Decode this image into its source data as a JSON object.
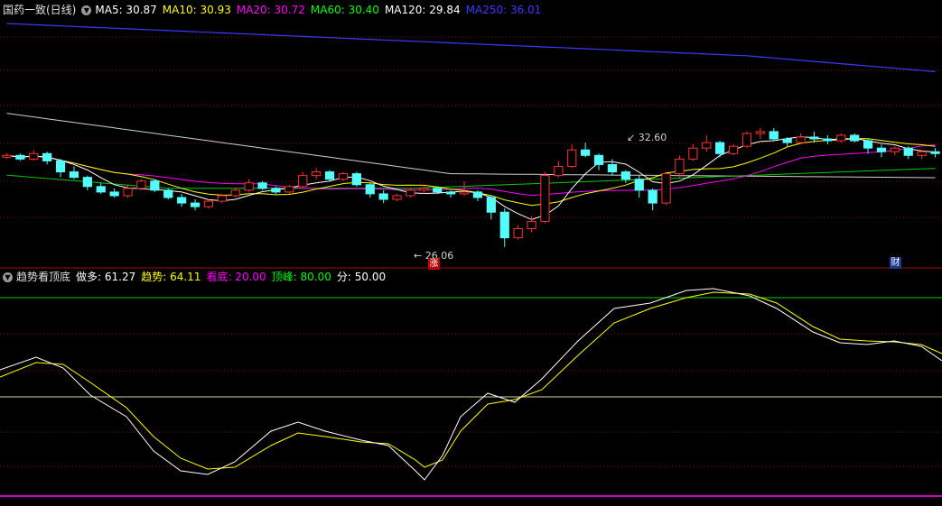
{
  "main_header": {
    "title": "国药一致(日线)",
    "indicators": [
      {
        "label": "MA5: 30.87",
        "color": "#ffffff"
      },
      {
        "label": "MA10: 30.93",
        "color": "#ffff00"
      },
      {
        "label": "MA20: 30.72",
        "color": "#ff00ff"
      },
      {
        "label": "MA60: 30.40",
        "color": "#00ff00"
      },
      {
        "label": "MA120: 29.84",
        "color": "#ffffff"
      },
      {
        "label": "MA250: 36.01",
        "color": "#3a3aff"
      }
    ]
  },
  "sub_header": {
    "title": "趋势看顶底",
    "indicators": [
      {
        "label": "做多: 61.27",
        "color": "#ffffff"
      },
      {
        "label": "趋势: 64.11",
        "color": "#ffff00"
      },
      {
        "label": "看底: 20.00",
        "color": "#ff00ff"
      },
      {
        "label": "顶峰: 80.00",
        "color": "#00ff00"
      },
      {
        "label": "分: 50.00",
        "color": "#ffffff"
      }
    ]
  },
  "annotations": {
    "high_label": "32.60",
    "low_label": "26.06",
    "rise_badge": "涨",
    "finance_badge": "财"
  },
  "colors": {
    "up": "#ff3232",
    "down": "#54fcfc",
    "grid": "#8b0000"
  },
  "chart_data": {
    "type": "candlestick",
    "x_count": 70,
    "price_range": [
      25.5,
      38.6
    ],
    "candles": [
      [
        31.0,
        31.2,
        30.9,
        31.1
      ],
      [
        31.1,
        31.2,
        30.8,
        30.9
      ],
      [
        30.9,
        31.4,
        30.8,
        31.2
      ],
      [
        31.2,
        31.3,
        30.6,
        30.8
      ],
      [
        30.8,
        30.9,
        29.9,
        30.2
      ],
      [
        30.2,
        30.5,
        29.8,
        29.9
      ],
      [
        29.9,
        30.0,
        29.2,
        29.4
      ],
      [
        29.4,
        29.6,
        29.0,
        29.1
      ],
      [
        29.1,
        29.3,
        28.8,
        28.9
      ],
      [
        28.9,
        29.5,
        28.8,
        29.3
      ],
      [
        29.3,
        29.8,
        29.2,
        29.7
      ],
      [
        29.7,
        29.8,
        29.1,
        29.2
      ],
      [
        29.2,
        29.3,
        28.7,
        28.8
      ],
      [
        28.8,
        29.0,
        28.3,
        28.5
      ],
      [
        28.5,
        28.7,
        28.1,
        28.3
      ],
      [
        28.3,
        28.7,
        28.2,
        28.6
      ],
      [
        28.6,
        29.0,
        28.5,
        28.9
      ],
      [
        28.9,
        29.3,
        28.8,
        29.2
      ],
      [
        29.2,
        29.8,
        29.1,
        29.6
      ],
      [
        29.6,
        29.7,
        29.2,
        29.3
      ],
      [
        29.3,
        29.4,
        29.0,
        29.1
      ],
      [
        29.1,
        29.5,
        29.0,
        29.4
      ],
      [
        29.4,
        30.2,
        29.3,
        30.0
      ],
      [
        30.0,
        30.4,
        29.8,
        30.2
      ],
      [
        30.2,
        30.3,
        29.7,
        29.8
      ],
      [
        29.8,
        30.2,
        29.7,
        30.1
      ],
      [
        30.1,
        30.2,
        29.4,
        29.5
      ],
      [
        29.5,
        29.6,
        28.8,
        29.0
      ],
      [
        29.0,
        29.2,
        28.5,
        28.7
      ],
      [
        28.7,
        29.0,
        28.6,
        28.9
      ],
      [
        28.9,
        29.3,
        28.8,
        29.2
      ],
      [
        29.2,
        29.4,
        29.0,
        29.3
      ],
      [
        29.3,
        29.4,
        29.0,
        29.1
      ],
      [
        29.1,
        29.2,
        28.8,
        29.0
      ],
      [
        29.0,
        29.7,
        28.9,
        29.1
      ],
      [
        29.1,
        29.2,
        28.6,
        28.8
      ],
      [
        28.8,
        28.9,
        27.6,
        28.0
      ],
      [
        28.0,
        28.2,
        26.1,
        26.6
      ],
      [
        26.6,
        27.3,
        26.5,
        27.1
      ],
      [
        27.1,
        27.8,
        26.9,
        27.5
      ],
      [
        27.5,
        30.2,
        27.4,
        30.0
      ],
      [
        30.0,
        30.8,
        29.9,
        30.5
      ],
      [
        30.5,
        31.7,
        30.4,
        31.4
      ],
      [
        31.4,
        31.8,
        31.0,
        31.1
      ],
      [
        31.1,
        31.2,
        30.3,
        30.6
      ],
      [
        30.6,
        30.9,
        30.0,
        30.2
      ],
      [
        30.2,
        30.3,
        29.6,
        29.8
      ],
      [
        29.8,
        30.0,
        28.8,
        29.2
      ],
      [
        29.2,
        29.3,
        28.1,
        28.5
      ],
      [
        28.5,
        30.2,
        28.4,
        30.1
      ],
      [
        30.1,
        31.1,
        29.9,
        30.9
      ],
      [
        30.9,
        31.7,
        30.8,
        31.5
      ],
      [
        31.5,
        32.2,
        31.3,
        31.8
      ],
      [
        31.8,
        31.9,
        31.0,
        31.2
      ],
      [
        31.2,
        31.7,
        31.1,
        31.6
      ],
      [
        31.6,
        32.4,
        31.5,
        32.3
      ],
      [
        32.3,
        32.6,
        32.0,
        32.4
      ],
      [
        32.4,
        32.6,
        31.9,
        32.0
      ],
      [
        32.0,
        32.1,
        31.6,
        31.8
      ],
      [
        31.8,
        32.3,
        31.7,
        32.1
      ],
      [
        32.1,
        32.4,
        31.8,
        32.0
      ],
      [
        32.0,
        32.2,
        31.7,
        31.9
      ],
      [
        31.9,
        32.3,
        31.8,
        32.2
      ],
      [
        32.2,
        32.3,
        31.8,
        31.9
      ],
      [
        31.9,
        32.0,
        31.2,
        31.5
      ],
      [
        31.5,
        31.7,
        31.0,
        31.3
      ],
      [
        31.3,
        31.6,
        31.1,
        31.5
      ],
      [
        31.5,
        31.6,
        30.9,
        31.1
      ],
      [
        31.1,
        31.4,
        30.9,
        31.3
      ],
      [
        31.3,
        31.5,
        31.0,
        31.2
      ]
    ]
  }
}
